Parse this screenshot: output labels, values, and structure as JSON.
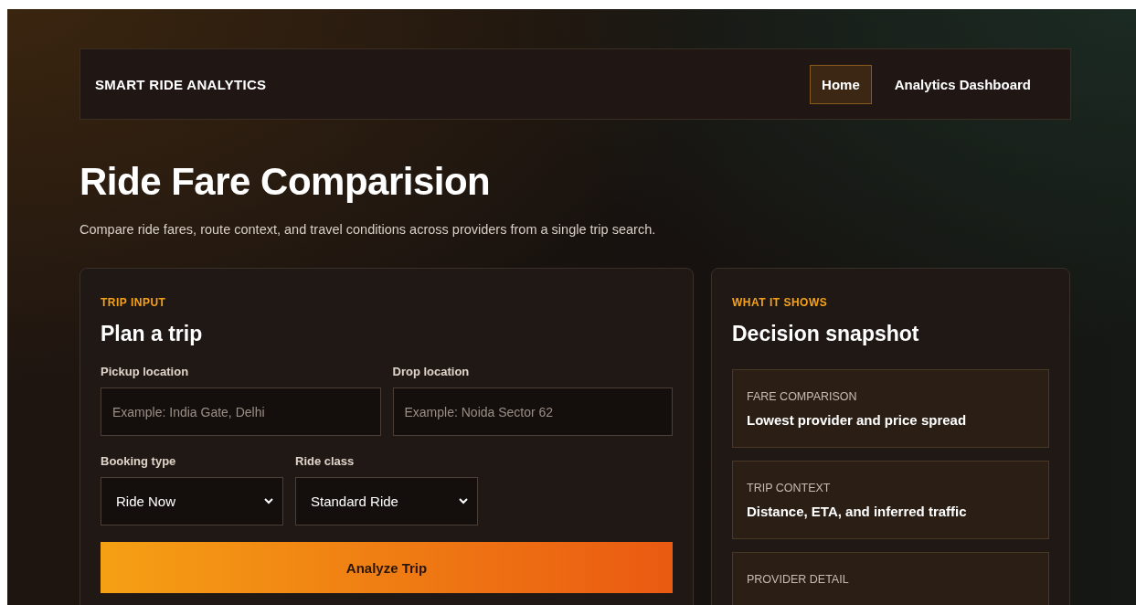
{
  "nav": {
    "brand": "SMART RIDE ANALYTICS",
    "links": [
      {
        "label": "Home",
        "selected": true
      },
      {
        "label": "Analytics Dashboard",
        "selected": false
      }
    ]
  },
  "page": {
    "title": "Ride Fare Comparision",
    "subtitle": "Compare ride fares, route context, and travel conditions across providers from a single trip search."
  },
  "trip_input": {
    "eyebrow": "TRIP INPUT",
    "heading": "Plan a trip",
    "text_fields": [
      {
        "label": "Pickup location",
        "placeholder": "Example: India Gate, Delhi"
      },
      {
        "label": "Drop location",
        "placeholder": "Example: Noida Sector 62"
      }
    ],
    "selects": [
      {
        "label": "Booking type",
        "value": "Ride Now"
      },
      {
        "label": "Ride class",
        "value": "Standard Ride"
      }
    ],
    "button": "Analyze Trip"
  },
  "snapshot": {
    "eyebrow": "WHAT IT SHOWS",
    "heading": "Decision snapshot",
    "items": [
      {
        "label": "FARE COMPARISON",
        "text": "Lowest provider and price spread"
      },
      {
        "label": "TRIP CONTEXT",
        "text": "Distance, ETA, and inferred traffic"
      },
      {
        "label": "PROVIDER DETAIL"
      }
    ]
  }
}
